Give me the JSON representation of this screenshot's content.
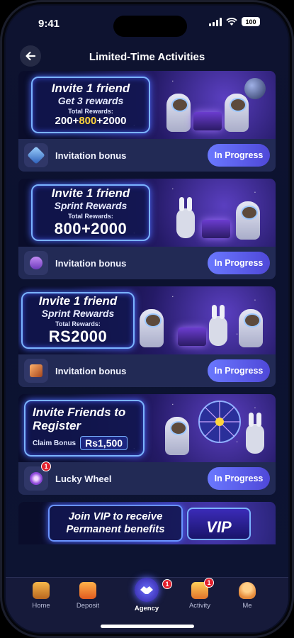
{
  "status_bar": {
    "time": "9:41",
    "battery": "100"
  },
  "header": {
    "title": "Limited-Time Activities"
  },
  "activities": [
    {
      "banner": {
        "title": "Invite 1 friend",
        "subtitle": "Get 3 rewards",
        "small": "Total Rewards:",
        "amount_parts": [
          "200",
          "+",
          "800",
          "+",
          "2000"
        ]
      },
      "label": "Invitation bonus",
      "button": "In Progress"
    },
    {
      "banner": {
        "title": "Invite 1 friend",
        "subtitle": "Sprint Rewards",
        "small": "Total Rewards:",
        "amount": "800+2000"
      },
      "label": "Invitation bonus",
      "button": "In Progress"
    },
    {
      "banner": {
        "title": "Invite 1 friend",
        "subtitle": "Sprint Rewards",
        "small": "Total Rewards:",
        "amount": "RS2000"
      },
      "label": "Invitation bonus",
      "button": "In Progress"
    },
    {
      "banner": {
        "title": "Invite Friends to",
        "subtitle": "Register",
        "small": "Claim Bonus",
        "amount": "Rs1,500"
      },
      "label": "Lucky Wheel",
      "button": "In Progress",
      "badge": "1"
    },
    {
      "banner": {
        "line1": "Join VIP to receive",
        "line2": "Permanent benefits",
        "badge": "VIP"
      }
    }
  ],
  "tabbar": {
    "items": [
      {
        "label": "Home"
      },
      {
        "label": "Deposit"
      },
      {
        "label": "Agency",
        "badge": "1"
      },
      {
        "label": "Activity",
        "badge": "1"
      },
      {
        "label": "Me"
      }
    ]
  },
  "colors": {
    "accent": "#5a5fe6",
    "background": "#0d1330",
    "badge": "#e3202d",
    "highlight": "#ffd43b"
  }
}
